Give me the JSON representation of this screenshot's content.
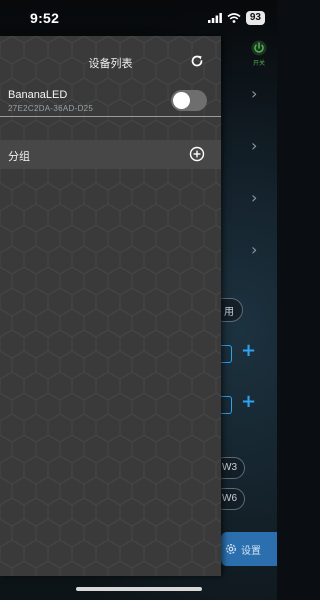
{
  "status_bar": {
    "time": "9:52",
    "battery": "93"
  },
  "drawer": {
    "title": "设备列表",
    "device": {
      "name": "BananaLED",
      "id": "27E2C2DA-36AD-D25",
      "enabled": false
    },
    "group_label": "分组"
  },
  "background_panel": {
    "power_label": "开关",
    "chip_partial": "用",
    "chip_w3": "W3",
    "chip_w6": "W6",
    "settings_label": "设置"
  },
  "colors": {
    "accent": "#2ea3f2",
    "power": "#4caf50",
    "drawer": "#3a3a3a"
  }
}
